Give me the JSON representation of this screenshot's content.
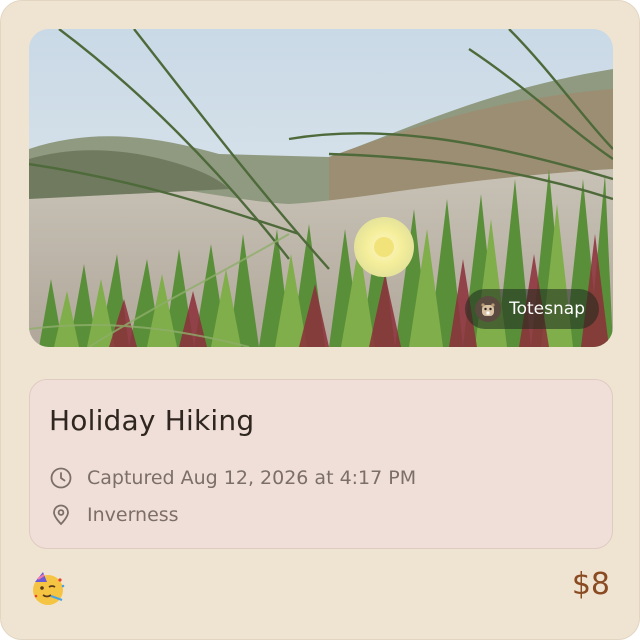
{
  "card": {
    "title": "Holiday Hiking",
    "captured": "Captured Aug 12, 2026 at 4:17 PM",
    "location": "Inverness",
    "attribution": "Totesnap",
    "price": "$8",
    "emoji": "partying-face-emoji"
  },
  "icons": {
    "clock": "clock-icon",
    "location": "map-pin-icon",
    "avatar": "beaver-avatar-icon"
  },
  "colors": {
    "card_bg": "#efe4d2",
    "info_bg": "#f0dfd8",
    "title": "#2f2620",
    "meta": "#7b6f68",
    "price": "#8a4b23"
  }
}
